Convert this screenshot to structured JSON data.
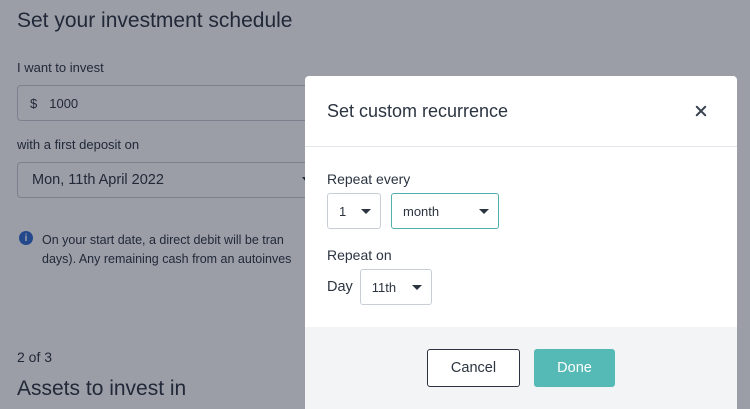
{
  "background": {
    "title": "Set your investment schedule",
    "invest_label": "I want to invest",
    "currency_symbol": "$",
    "amount_value": "1000",
    "first_deposit_label": "with a first deposit on",
    "first_deposit_value": "Mon, 11th April 2022",
    "info_line1": "On your start date, a direct debit will be tran",
    "info_line2": "days). Any remaining cash from an autoinves",
    "step": "2 of 3",
    "subtitle": "Assets to invest in"
  },
  "modal": {
    "title": "Set custom recurrence",
    "repeat_every_label": "Repeat every",
    "repeat_count": "1",
    "repeat_unit": "month",
    "repeat_on_label": "Repeat on",
    "day_label": "Day",
    "day_value": "11th",
    "cancel_label": "Cancel",
    "done_label": "Done"
  },
  "colors": {
    "accent": "#55b9b6",
    "focus_border": "#4fb0ad",
    "info_icon": "#2f6dd1",
    "overlay": "rgba(18,24,45,0.42)"
  },
  "icons": {
    "close": "close-icon",
    "info": "info-icon",
    "caret": "chevron-down-icon"
  }
}
